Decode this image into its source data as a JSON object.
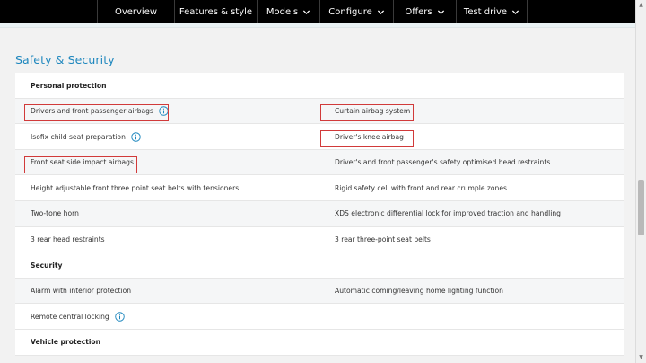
{
  "nav": {
    "items": [
      {
        "label": "Overview",
        "dropdown": false
      },
      {
        "label": "Features & style",
        "dropdown": false
      },
      {
        "label": "Models",
        "dropdown": true
      },
      {
        "label": "Configure",
        "dropdown": true
      },
      {
        "label": "Offers",
        "dropdown": true
      },
      {
        "label": "Test drive",
        "dropdown": true
      }
    ]
  },
  "section": {
    "title": "Safety & Security"
  },
  "rows": [
    {
      "type": "header",
      "left": "Personal protection",
      "right": ""
    },
    {
      "type": "item",
      "left": "Drivers and front passenger airbags",
      "left_info": true,
      "right": "Curtain airbag system",
      "right_info": false
    },
    {
      "type": "item",
      "left": "Isofix child seat preparation",
      "left_info": true,
      "right": "Driver's knee airbag",
      "right_info": false
    },
    {
      "type": "item",
      "left": "Front seat side impact airbags",
      "left_info": false,
      "right": "Driver's and front passenger's safety optimised head restraints",
      "right_info": false
    },
    {
      "type": "item",
      "left": "Height adjustable front three point seat belts with tensioners",
      "left_info": false,
      "right": "Rigid safety cell with front and rear crumple zones",
      "right_info": false
    },
    {
      "type": "item",
      "left": "Two-tone horn",
      "left_info": false,
      "right": "XDS electronic differential lock for improved traction and handling",
      "right_info": false
    },
    {
      "type": "item",
      "left": "3 rear head restraints",
      "left_info": false,
      "right": "3 rear three-point seat belts",
      "right_info": false
    },
    {
      "type": "header",
      "left": "Security",
      "right": ""
    },
    {
      "type": "item",
      "left": "Alarm with interior protection",
      "left_info": false,
      "right": "Automatic coming/leaving home lighting function",
      "right_info": false
    },
    {
      "type": "item",
      "left": "Remote central locking",
      "left_info": true,
      "right": "",
      "right_info": false
    },
    {
      "type": "header",
      "left": "Vehicle protection",
      "right": ""
    }
  ],
  "colors": {
    "accent": "#1e87be",
    "highlight": "#d13a3a",
    "nav_bg": "#000000"
  }
}
